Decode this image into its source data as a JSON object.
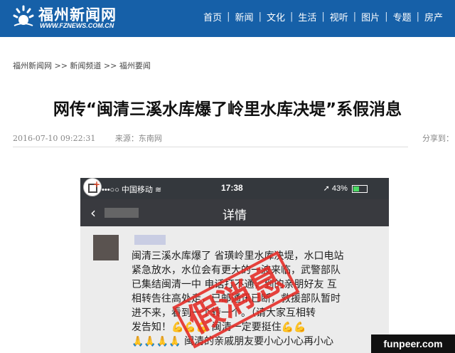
{
  "header": {
    "logo_text": "福州新闻网",
    "logo_sub": "WWW.FZNEWS.COM.CN",
    "nav": [
      "首页",
      "新闻",
      "文化",
      "生活",
      "视听",
      "图片",
      "专题",
      "房产"
    ],
    "colors": {
      "header_bg": "#1660a8"
    }
  },
  "breadcrumb": "福州新闻网 >> 新闻频道 >> 福州要闻",
  "article": {
    "title": "网传“闽清三溪水库爆了岭里水库决堤”系假消息",
    "date": "2016-07-10 09:22:31",
    "source": "来源：东南网",
    "share": "分享到："
  },
  "screenshot": {
    "carrier": "中国移动",
    "time": "17:38",
    "battery": "43%",
    "battery_level": 0.43,
    "page_title": "详情",
    "lines": [
      "闽清三溪水库爆了 省璜岭里水库决堤，水口电站",
      "紧急放水，水位会有更大的一波来临，武警部队",
      "已集结闽清一中 电话打不通，到的亲朋好友 互",
      "相转告往高处走，已邮通讯已断，救援部队暂时",
      "进不来，看到一个转一个。（请大家互相转",
      "发告知！💪💪💪 闽清一定要挺住💪💪",
      "🙏🙏🙏🙏 闽清的亲戚朋友要小心小心再小心"
    ],
    "stamp": "假消息"
  },
  "watermark": "funpeer.com"
}
